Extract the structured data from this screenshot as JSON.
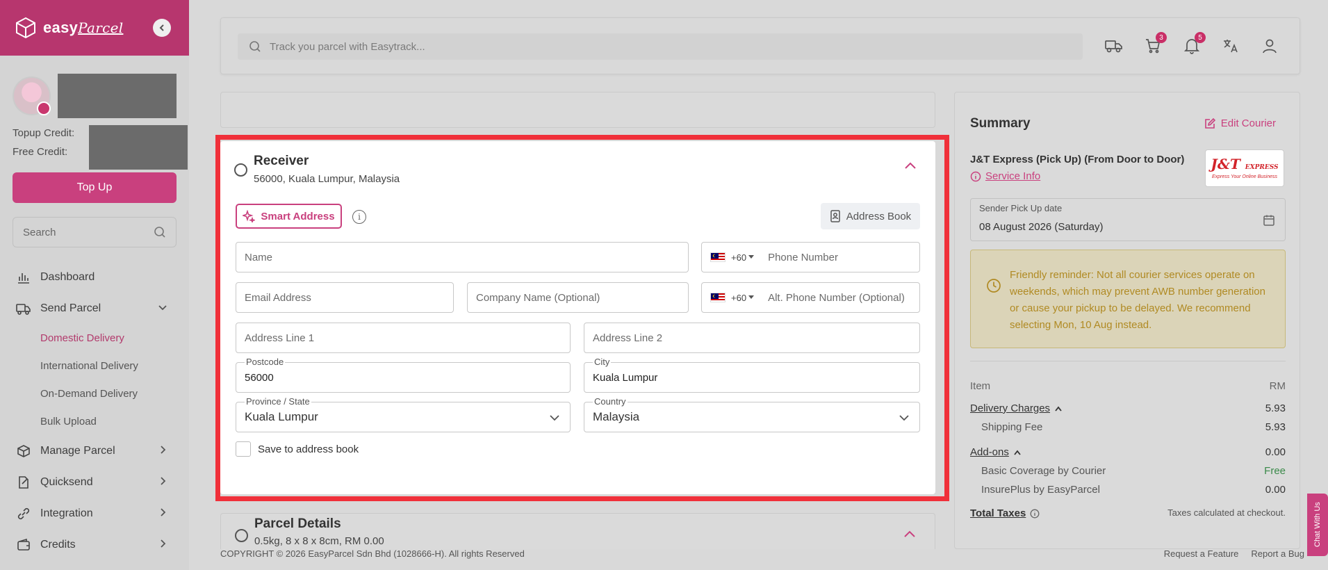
{
  "brand": {
    "name": "easy",
    "name_script": "Parcel"
  },
  "sidebar": {
    "topup_credit_label": "Topup Credit:",
    "free_credit_label": "Free Credit:",
    "topup_button": "Top Up",
    "search_placeholder": "Search",
    "nav": {
      "dashboard": "Dashboard",
      "send_parcel": "Send Parcel",
      "sub": [
        "Domestic Delivery",
        "International Delivery",
        "On-Demand Delivery",
        "Bulk Upload"
      ],
      "manage_parcel": "Manage Parcel",
      "quicksend": "Quicksend",
      "integration": "Integration",
      "credits": "Credits"
    }
  },
  "topbar": {
    "search_placeholder": "Track you parcel with Easytrack...",
    "cart_count": "3",
    "notif_count": "5"
  },
  "receiver": {
    "title": "Receiver",
    "subtitle": "56000, Kuala Lumpur, Malaysia",
    "smart_address": "Smart Address",
    "address_book": "Address Book",
    "name_placeholder": "Name",
    "country_code": "+60",
    "phone_placeholder": "Phone Number",
    "email_placeholder": "Email Address",
    "company_placeholder": "Company Name (Optional)",
    "alt_phone_placeholder": "Alt. Phone Number (Optional)",
    "address1_placeholder": "Address Line 1",
    "address2_placeholder": "Address Line 2",
    "postcode_label": "Postcode",
    "postcode_value": "56000",
    "city_label": "City",
    "city_value": "Kuala Lumpur",
    "state_label": "Province / State",
    "state_value": "Kuala Lumpur",
    "country_label": "Country",
    "country_value": "Malaysia",
    "save_label": "Save to address book"
  },
  "parcel": {
    "title": "Parcel Details",
    "subtitle": "0.5kg, 8 x 8 x 8cm, RM 0.00"
  },
  "summary": {
    "title": "Summary",
    "edit_courier": "Edit Courier",
    "service_name": "J&T Express (Pick Up) (From Door to Door)",
    "service_info": "Service Info",
    "logo_main": "J&T",
    "logo_express": "EXPRESS",
    "logo_tagline": "Express Your Online Business",
    "pickup_label": "Sender Pick Up date",
    "pickup_value": "08 August 2026 (Saturday)",
    "reminder": "Friendly reminder: Not all courier services operate on weekends, which may prevent AWB number generation or cause your pickup to be delayed. We recommend selecting Mon, 10 Aug instead.",
    "item_label": "Item",
    "currency": "RM",
    "delivery_charges": "Delivery Charges",
    "delivery_charges_value": "5.93",
    "shipping_fee": "Shipping Fee",
    "shipping_fee_value": "5.93",
    "addons": "Add-ons",
    "addons_value": "0.00",
    "basic_coverage": "Basic Coverage by Courier",
    "basic_coverage_value": "Free",
    "insureplus": "InsurePlus by EasyParcel",
    "insureplus_value": "0.00",
    "total_taxes": "Total Taxes",
    "taxes_note": "Taxes calculated at checkout."
  },
  "footer": {
    "copyright": "COPYRIGHT © 2026 EasyParcel Sdn Bhd (1028666-H). All rights Reserved",
    "request_feature": "Request a Feature",
    "report_bug": "Report a Bug"
  },
  "chat": {
    "label": "Chat With Us"
  },
  "colors": {
    "brand": "#c9407e",
    "highlight": "#f0303a",
    "reminder_text": "#b08a23"
  }
}
